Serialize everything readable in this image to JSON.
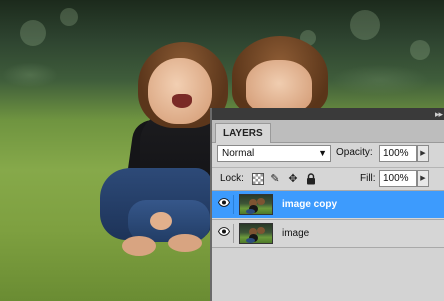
{
  "colors": {
    "panel_bg": "#d6d6d6",
    "selected_layer": "#3d9bfd",
    "tab_bar": "#bdbdbd"
  },
  "panel": {
    "tab_label": "LAYERS",
    "blend_mode": "Normal",
    "opacity_label": "Opacity:",
    "opacity_value": "100%",
    "lock_label": "Lock:",
    "fill_label": "Fill:",
    "fill_value": "100%",
    "lock_icons": [
      "transparency-lock-icon",
      "brush-lock-icon",
      "move-lock-icon",
      "padlock-icon"
    ]
  },
  "layers": [
    {
      "name": "image copy",
      "selected": true,
      "visible": true
    },
    {
      "name": "image",
      "selected": false,
      "visible": true
    }
  ]
}
